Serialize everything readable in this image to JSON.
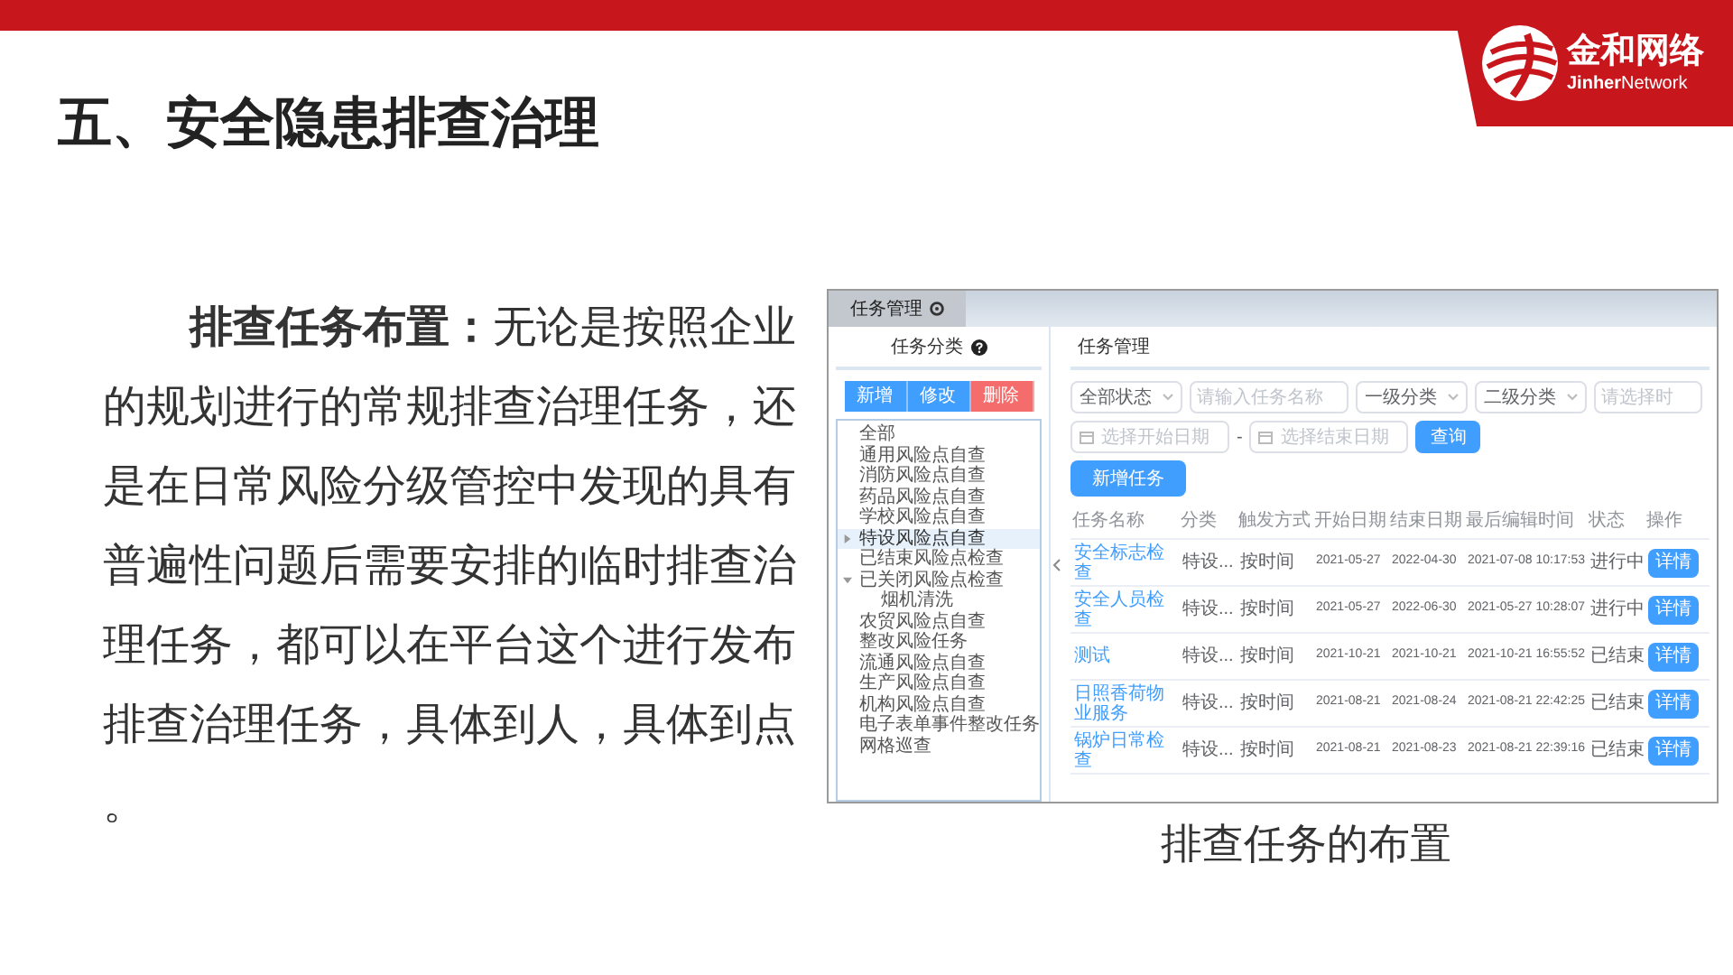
{
  "logo": {
    "name": "金和网络",
    "subtitle": "**Jinher**Network"
  },
  "slide": {
    "title": "五、安全隐患排查治理",
    "paragraph": "**排查任务布置：**无论是按照企业的规划进行的常规排查治理任务，还是在日常风险分级管控中发现的具有普遍性问题后需要安排的临时排查治理任务，都可以在平台这个进行发布排查治理任务，具体到人，具体到点。",
    "caption": "排查任务的布置"
  },
  "app": {
    "tabs": [
      {
        "label": "任务管理",
        "selected": true
      }
    ],
    "category_panel": {
      "title": "任务分类",
      "buttons": [
        {
          "label": "新增",
          "kind": "primary"
        },
        {
          "label": "修改",
          "kind": "primary"
        },
        {
          "label": "删除",
          "kind": "danger"
        }
      ],
      "tree": [
        {
          "label": "全部",
          "selected": false
        },
        {
          "label": "通用风险点自查",
          "selected": false
        },
        {
          "label": "消防风险点自查",
          "selected": false
        },
        {
          "label": "药品风险点自查",
          "selected": false
        },
        {
          "label": "学校风险点自查",
          "selected": false
        },
        {
          "label": "特设风险点自查",
          "selected": true,
          "expanded": false
        },
        {
          "label": "已结束风险点检查",
          "selected": false
        },
        {
          "label": "已关闭风险点检查",
          "selected": false,
          "expanded": true,
          "children": [
            {
              "label": "烟机清洗",
              "selected": false
            }
          ]
        },
        {
          "label": "农贸风险点自查",
          "selected": false
        },
        {
          "label": "整改风险任务",
          "selected": false
        },
        {
          "label": "流通风险点自查",
          "selected": false
        },
        {
          "label": "生产风险点自查",
          "selected": false
        },
        {
          "label": "机构风险点自查",
          "selected": false
        },
        {
          "label": "电子表单事件整改任务",
          "selected": false
        },
        {
          "label": "网格巡查",
          "selected": false
        }
      ]
    },
    "task_panel": {
      "title": "任务管理",
      "filters": [
        {
          "kind": "select",
          "value": "全部状态"
        },
        {
          "kind": "input",
          "placeholder": "请输入任务名称"
        },
        {
          "kind": "select",
          "value": "一级分类"
        },
        {
          "kind": "select",
          "value": "二级分类"
        },
        {
          "kind": "input",
          "placeholder": "请选择时"
        }
      ],
      "start_date_placeholder": "选择开始日期",
      "date_separator": "-",
      "end_date_placeholder": "选择结束日期",
      "search_button": "查询",
      "add_button": "新增任务",
      "table": {
        "columns": [
          "任务名称",
          "分类",
          "触发方式",
          "开始日期",
          "结束日期",
          "最后编辑时间",
          "状态",
          "操作"
        ],
        "rows": [
          {
            "cells": [
              "安全标志检查",
              "特设...",
              "按时间",
              "2021-05-27",
              "2022-04-30",
              "2021-07-08 10:17:53",
              "进行中"
            ],
            "action": "详情"
          },
          {
            "cells": [
              "安全人员检查",
              "特设...",
              "按时间",
              "2021-05-27",
              "2022-06-30",
              "2021-05-27 10:28:07",
              "进行中"
            ],
            "action": "详情"
          },
          {
            "cells": [
              "测试",
              "特设...",
              "按时间",
              "2021-10-21",
              "2021-10-21",
              "2021-10-21 16:55:52",
              "已结束"
            ],
            "action": "详情"
          },
          {
            "cells": [
              "日照香荷物业服务",
              "特设...",
              "按时间",
              "2021-08-21",
              "2021-08-24",
              "2021-08-21 22:42:25",
              "已结束"
            ],
            "action": "详情"
          },
          {
            "cells": [
              "锅炉日常检查",
              "特设...",
              "按时间",
              "2021-08-21",
              "2021-08-23",
              "2021-08-21 22:39:16",
              "已结束"
            ],
            "action": "详情"
          }
        ]
      }
    }
  }
}
